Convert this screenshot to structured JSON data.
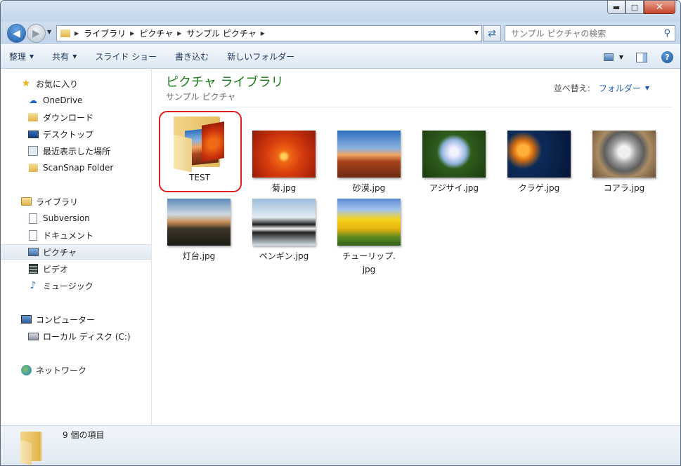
{
  "window": {
    "controls": {
      "minimize": "▬",
      "maximize": "□",
      "close": "✕"
    }
  },
  "address": {
    "crumbs": [
      "ライブラリ",
      "ピクチャ",
      "サンプル ピクチャ"
    ],
    "search_placeholder": "サンプル ピクチャの検索"
  },
  "toolbar": {
    "organize": "整理",
    "share": "共有",
    "slideshow": "スライド ショー",
    "burn": "書き込む",
    "new_folder": "新しいフォルダー"
  },
  "sidebar": {
    "favorites": {
      "header": "お気に入り",
      "items": [
        "OneDrive",
        "ダウンロード",
        "デスクトップ",
        "最近表示した場所",
        "ScanSnap Folder"
      ]
    },
    "libraries": {
      "header": "ライブラリ",
      "items": [
        "Subversion",
        "ドキュメント",
        "ピクチャ",
        "ビデオ",
        "ミュージック"
      ],
      "selected": "ピクチャ"
    },
    "computer": {
      "header": "コンピューター",
      "items": [
        "ローカル ディスク (C:)"
      ]
    },
    "network": {
      "header": "ネットワーク"
    }
  },
  "content": {
    "title": "ピクチャ ライブラリ",
    "subtitle": "サンプル ピクチャ",
    "arrange_label": "並べ替え:",
    "arrange_value": "フォルダー",
    "items": [
      {
        "name": "TEST",
        "type": "folder"
      },
      {
        "name": "菊.jpg",
        "type": "image"
      },
      {
        "name": "砂漠.jpg",
        "type": "image"
      },
      {
        "name": "アジサイ.jpg",
        "type": "image"
      },
      {
        "name": "クラゲ.jpg",
        "type": "image"
      },
      {
        "name": "コアラ.jpg",
        "type": "image"
      },
      {
        "name": "灯台.jpg",
        "type": "image"
      },
      {
        "name": "ペンギン.jpg",
        "type": "image"
      },
      {
        "name": "チューリップ.\njpg",
        "type": "image"
      }
    ]
  },
  "status": {
    "count_text": "9 個の項目"
  },
  "colors": {
    "title_green": "#1b7a1b",
    "link_blue": "#1e5bb0",
    "highlight_red": "#e02020"
  }
}
